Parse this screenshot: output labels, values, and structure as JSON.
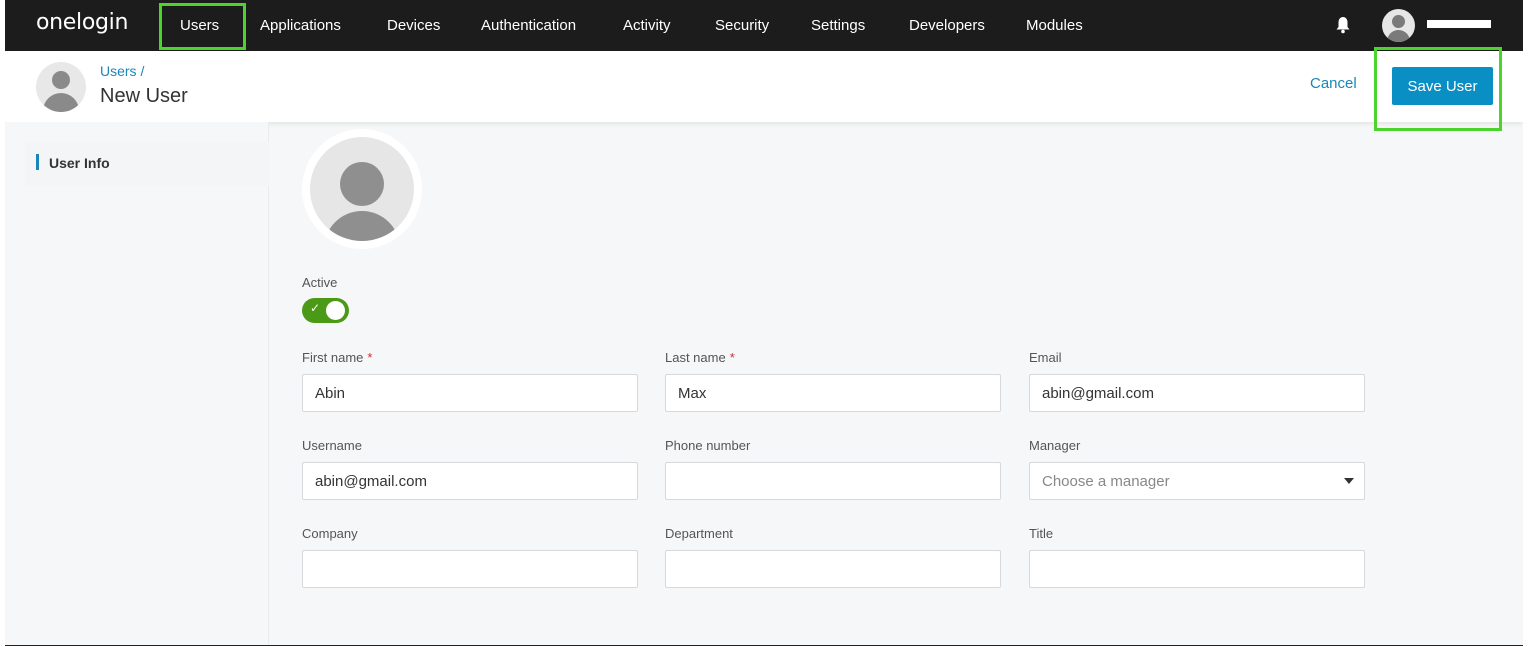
{
  "brand": {
    "logo_text": "onelogin"
  },
  "nav": {
    "items": [
      {
        "label": "Users"
      },
      {
        "label": "Applications"
      },
      {
        "label": "Devices"
      },
      {
        "label": "Authentication"
      },
      {
        "label": "Activity"
      },
      {
        "label": "Security"
      },
      {
        "label": "Settings"
      },
      {
        "label": "Developers"
      },
      {
        "label": "Modules"
      }
    ],
    "bell_icon": "bell-icon",
    "avatar_icon": "user-avatar-icon"
  },
  "header": {
    "breadcrumb": "Users /",
    "title": "New User",
    "cancel_label": "Cancel",
    "save_label": "Save User"
  },
  "sidebar": {
    "items": [
      {
        "label": "User Info"
      }
    ]
  },
  "form": {
    "active_label": "Active",
    "active": true,
    "first_name": {
      "label": "First name",
      "required_mark": "*",
      "value": "Abin"
    },
    "last_name": {
      "label": "Last name",
      "required_mark": "*",
      "value": "Max"
    },
    "email": {
      "label": "Email",
      "value": "abin@gmail.com"
    },
    "username": {
      "label": "Username",
      "value": "abin@gmail.com"
    },
    "phone": {
      "label": "Phone number",
      "value": ""
    },
    "manager": {
      "label": "Manager",
      "placeholder": "Choose a manager"
    },
    "company": {
      "label": "Company",
      "value": ""
    },
    "department": {
      "label": "Department",
      "value": ""
    },
    "title": {
      "label": "Title",
      "value": ""
    }
  },
  "colors": {
    "nav_bg": "#1c1c1c",
    "accent": "#0a8fc4",
    "link": "#1a86b8",
    "toggle_on": "#4a9a16",
    "highlight": "#4cd42c"
  }
}
